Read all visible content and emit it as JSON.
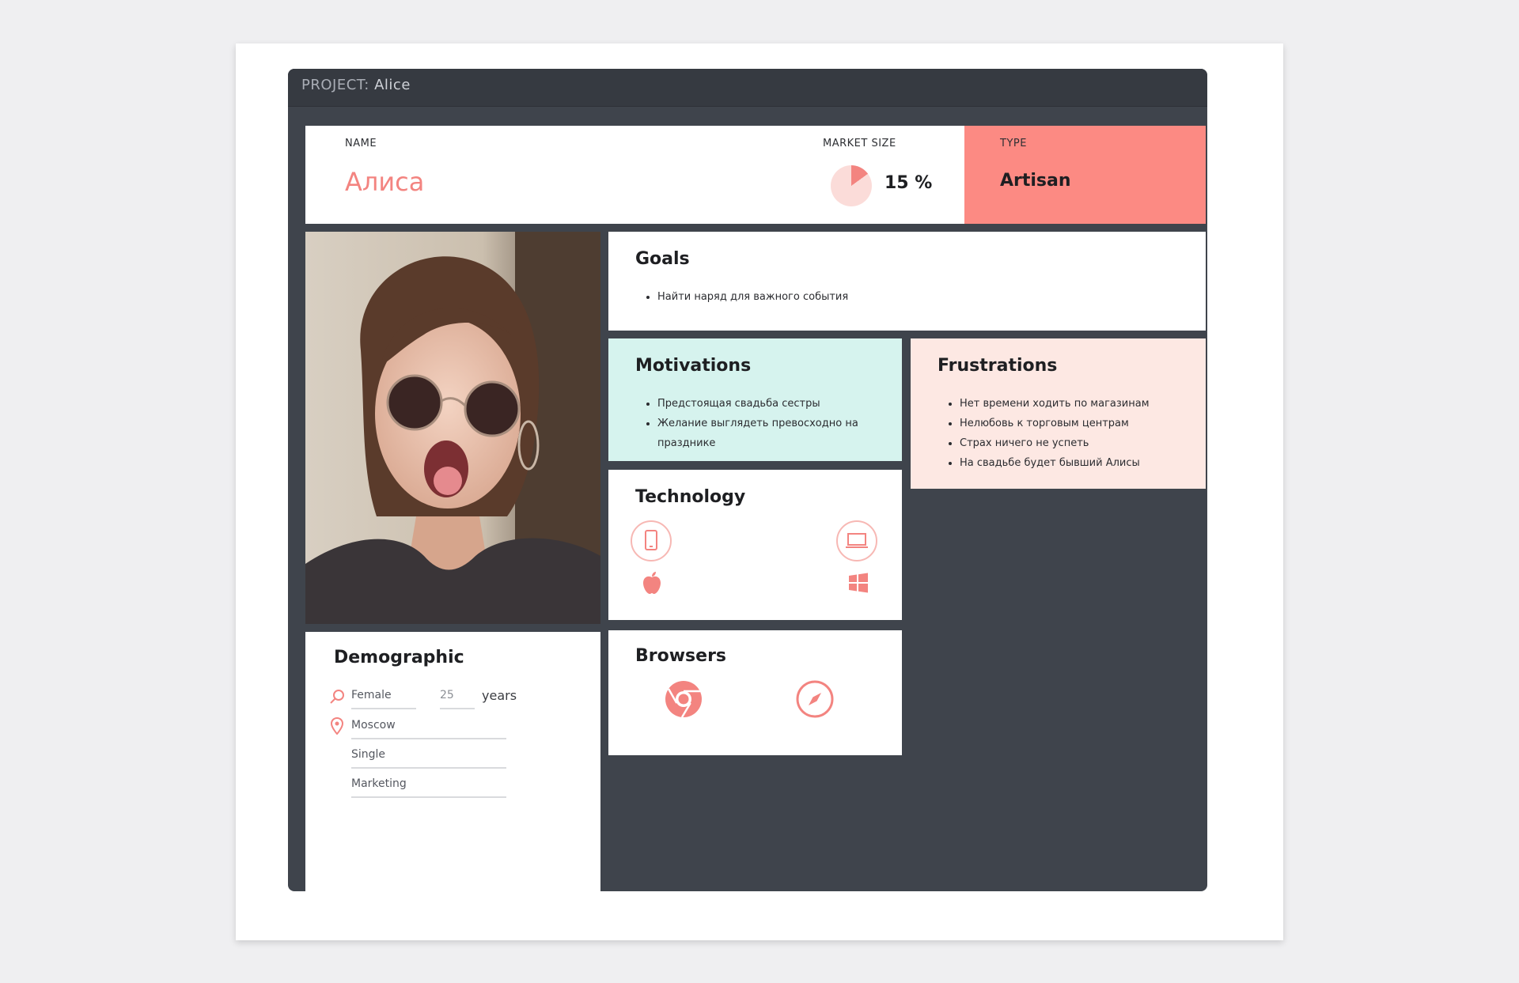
{
  "window": {
    "project_prefix": "PROJECT:",
    "project_name": "Alice"
  },
  "header": {
    "name_label": "NAME",
    "name_value": "Алиса",
    "market_label": "MARKET SIZE",
    "market_value": "15 %",
    "market_fraction": 0.15,
    "type_label": "TYPE",
    "type_value": "Artisan"
  },
  "goals": {
    "title": "Goals",
    "items": [
      "Найти наряд для важного события"
    ]
  },
  "motivations": {
    "title": "Motivations",
    "items": [
      "Предстоящая свадьба сестры",
      "Желание выглядеть превосходно на празднике"
    ]
  },
  "frustrations": {
    "title": "Frustrations",
    "items": [
      "Нет времени ходить по магазинам",
      "Нелюбовь к торговым центрам",
      "Страх ничего не успеть",
      "На свадьбе будет бывший Алисы"
    ]
  },
  "technology": {
    "title": "Technology",
    "icons": [
      "smartphone-icon",
      "laptop-icon",
      "apple-icon",
      "windows-icon"
    ]
  },
  "browsers": {
    "title": "Browsers",
    "icons": [
      "chrome-icon",
      "safari-icon"
    ]
  },
  "demographic": {
    "title": "Demographic",
    "gender": "Female",
    "age": "25",
    "age_unit": "years",
    "city": "Moscow",
    "status": "Single",
    "occupation": "Marketing"
  },
  "colors": {
    "accent": "#f38480",
    "type_bg": "#fc8a83",
    "motivations_bg": "#d6f3ee",
    "frustrations_bg": "#fde8e3",
    "window_bg": "#3f444c"
  }
}
